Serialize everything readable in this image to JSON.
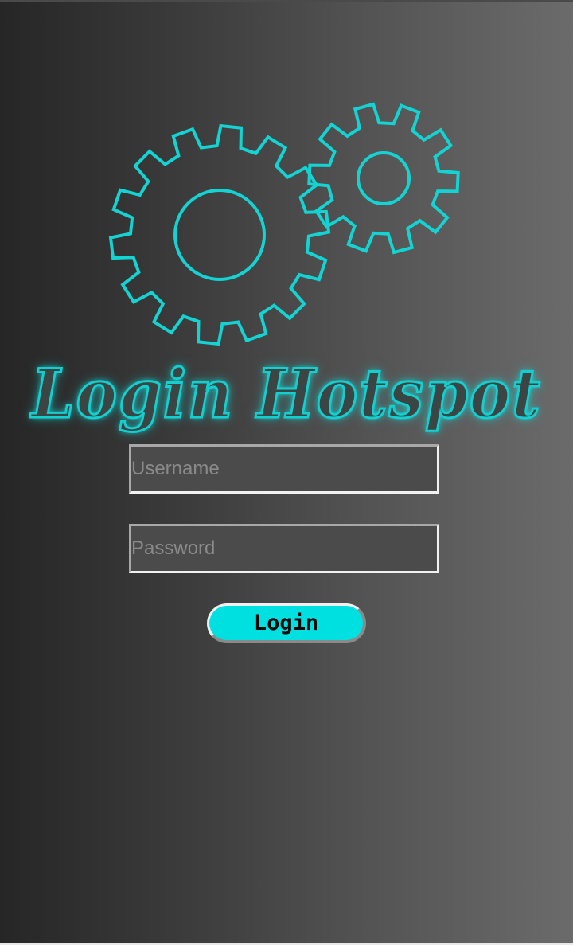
{
  "app": {
    "title": "Login Hotspot",
    "accent_color": "#13cfcf"
  },
  "logo": {
    "icon": "gears-icon"
  },
  "form": {
    "username_placeholder": "Username",
    "password_placeholder": "Password",
    "login_label": "Login"
  }
}
